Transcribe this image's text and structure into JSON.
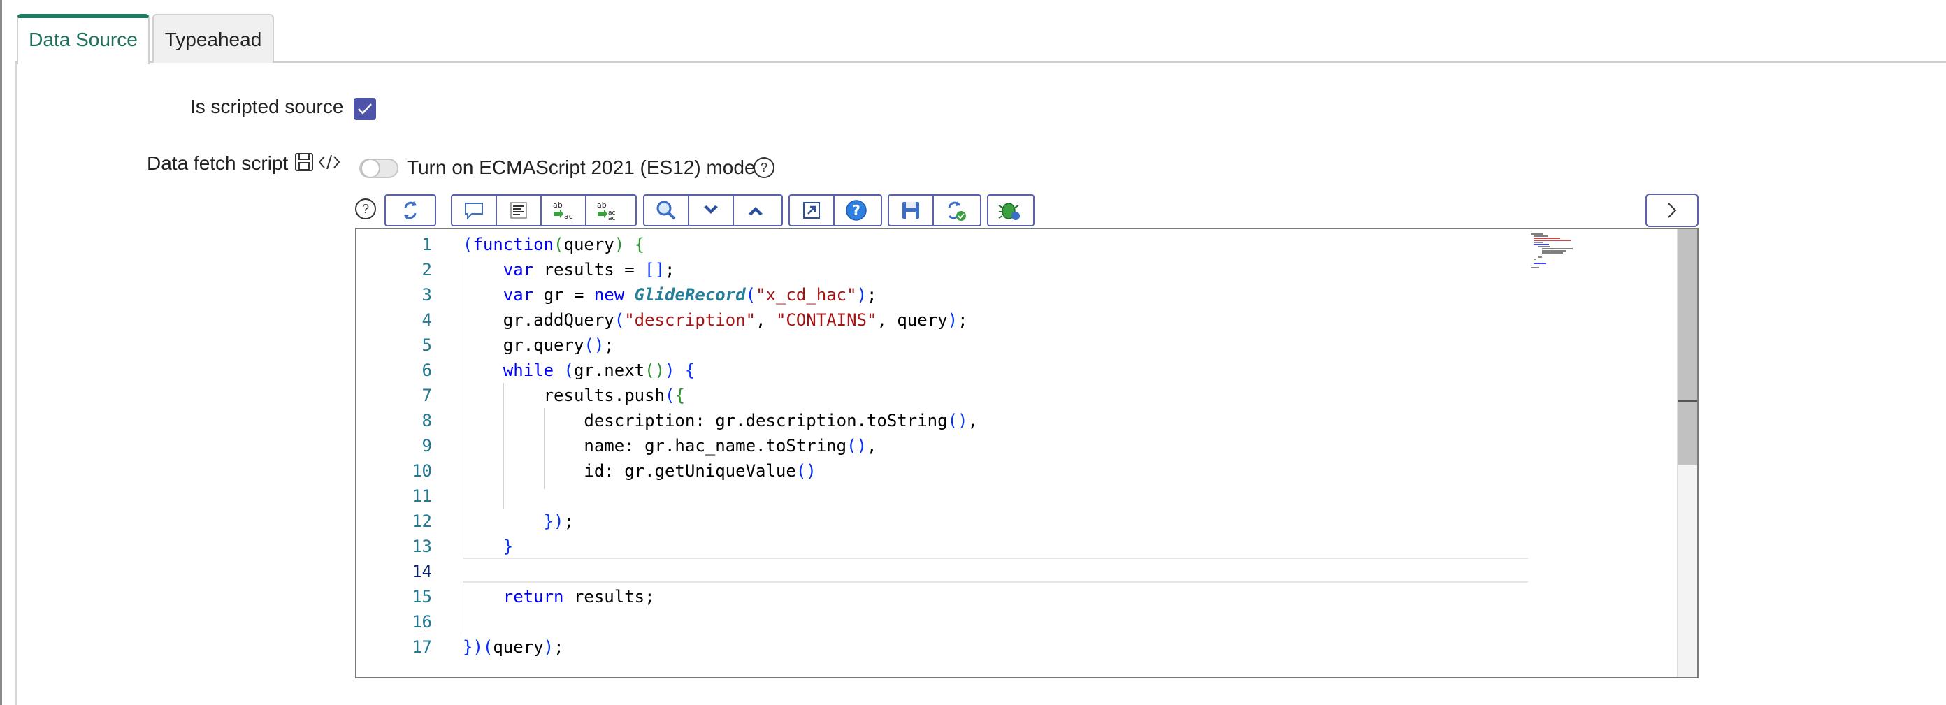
{
  "tabs": [
    {
      "label": "Data Source",
      "active": true
    },
    {
      "label": "Typeahead",
      "active": false
    }
  ],
  "form": {
    "scripted_label": "Is scripted source",
    "scripted_checked": true,
    "script_label": "Data fetch script",
    "es_toggle_label": "Turn on ECMAScript 2021 (ES12) mode",
    "es_toggle_on": false
  },
  "toolbar": {
    "help_icon": "question-circle-icon",
    "groups": [
      [
        "refresh-script-icon"
      ],
      [
        "comment-icon",
        "format-icon",
        "replace-icon",
        "replace-all-icon"
      ],
      [
        "search-icon",
        "next-icon",
        "previous-icon"
      ],
      [
        "open-fullscreen-icon",
        "help-icon"
      ],
      [
        "save-icon",
        "sync-icon",
        "debug-icon"
      ]
    ],
    "expand_icon": "chevron-right-icon"
  },
  "editor": {
    "active_line": 14,
    "lines": [
      {
        "n": "1",
        "code": "(function(query) {"
      },
      {
        "n": "2",
        "code": "    var results = [];"
      },
      {
        "n": "3",
        "code": "    var gr = new GlideRecord(\"x_cd_hac\");"
      },
      {
        "n": "4",
        "code": "    gr.addQuery(\"description\", \"CONTAINS\", query);"
      },
      {
        "n": "5",
        "code": "    gr.query();"
      },
      {
        "n": "6",
        "code": "    while (gr.next()) {"
      },
      {
        "n": "7",
        "code": "        results.push({"
      },
      {
        "n": "8",
        "code": "            description: gr.description.toString(),"
      },
      {
        "n": "9",
        "code": "            name: gr.hac_name.toString(),"
      },
      {
        "n": "10",
        "code": "            id: gr.getUniqueValue()"
      },
      {
        "n": "11",
        "code": ""
      },
      {
        "n": "12",
        "code": "        });"
      },
      {
        "n": "13",
        "code": "    }"
      },
      {
        "n": "14",
        "code": ""
      },
      {
        "n": "15",
        "code": "    return results;"
      },
      {
        "n": "16",
        "code": ""
      },
      {
        "n": "17",
        "code": "})(query);"
      }
    ]
  },
  "colors": {
    "accent": "#1f7a62",
    "checkbox": "#4d53a9",
    "toolbar_border": "#5a62b0"
  }
}
